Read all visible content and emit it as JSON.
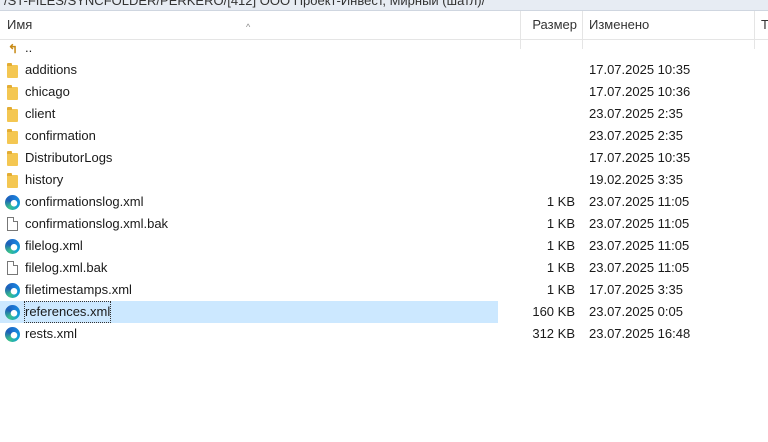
{
  "path": "/ST-FILES/SYNCFOLDER/PERKERO/[412] ООО Проект-Инвест, Мирный (шатл)/",
  "columns": {
    "name": "Имя",
    "size": "Размер",
    "modified": "Изменено",
    "type": "Т"
  },
  "files": [
    {
      "name": "..",
      "icon": "parent-folder-icon",
      "size": "",
      "modified": ""
    },
    {
      "name": "additions",
      "icon": "folder-icon",
      "size": "",
      "modified": "17.07.2025 10:35"
    },
    {
      "name": "chicago",
      "icon": "folder-icon",
      "size": "",
      "modified": "17.07.2025 10:36"
    },
    {
      "name": "client",
      "icon": "folder-icon",
      "size": "",
      "modified": "23.07.2025 2:35"
    },
    {
      "name": "confirmation",
      "icon": "folder-icon",
      "size": "",
      "modified": "23.07.2025 2:35"
    },
    {
      "name": "DistributorLogs",
      "icon": "folder-icon",
      "size": "",
      "modified": "17.07.2025 10:35"
    },
    {
      "name": "history",
      "icon": "folder-icon",
      "size": "",
      "modified": "19.02.2025 3:35"
    },
    {
      "name": "confirmationslog.xml",
      "icon": "edge-xml-icon",
      "size": "1 KB",
      "modified": "23.07.2025 11:05"
    },
    {
      "name": "confirmationslog.xml.bak",
      "icon": "file-icon",
      "size": "1 KB",
      "modified": "23.07.2025 11:05"
    },
    {
      "name": "filelog.xml",
      "icon": "edge-xml-icon",
      "size": "1 KB",
      "modified": "23.07.2025 11:05"
    },
    {
      "name": "filelog.xml.bak",
      "icon": "file-icon",
      "size": "1 KB",
      "modified": "23.07.2025 11:05"
    },
    {
      "name": "filetimestamps.xml",
      "icon": "edge-xml-icon",
      "size": "1 KB",
      "modified": "17.07.2025 3:35"
    },
    {
      "name": "references.xml",
      "icon": "edge-xml-icon",
      "size": "160 KB",
      "modified": "23.07.2025 0:05",
      "selected": true
    },
    {
      "name": "rests.xml",
      "icon": "edge-xml-icon",
      "size": "312 KB",
      "modified": "23.07.2025 16:48"
    }
  ]
}
